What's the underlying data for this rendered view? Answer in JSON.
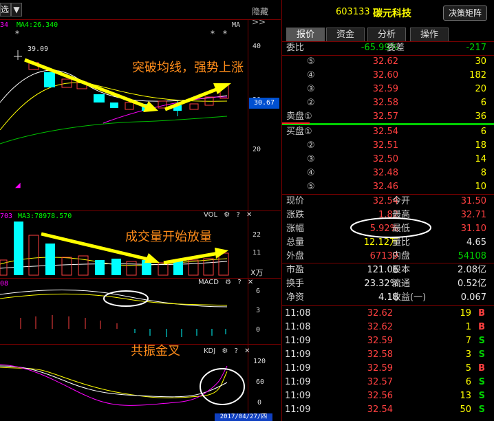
{
  "topbar": {
    "select_label": "选",
    "hide_label": "隐藏>>"
  },
  "kline": {
    "ma_label": "MA4:26.340",
    "ma_label_right": "MA",
    "left_stub": "34",
    "peak_label": "39.09",
    "price_axis": [
      "40",
      "30",
      "20"
    ],
    "current_price_tag": "30.67",
    "annotation": "突破均线，强势上涨"
  },
  "volume": {
    "left_stub": "703",
    "ma_label": "MA3:78978.570",
    "panel_name": "VOL",
    "axis": [
      "22",
      "11"
    ],
    "unit": "X万",
    "annotation": "成交量开始放量"
  },
  "macd": {
    "left_stub": "08",
    "panel_name": "MACD",
    "axis": [
      "6",
      "3",
      "0"
    ]
  },
  "kdj": {
    "panel_name": "KDJ",
    "axis": [
      "120",
      "60",
      "0"
    ],
    "annotation": "共振金叉",
    "date_label": "2017/04/27/四"
  },
  "quote": {
    "code": "603133",
    "name": "碳元科技",
    "matrix_button": "决策矩阵",
    "tabs": [
      "报价",
      "资金",
      "分析",
      "操作"
    ],
    "webi": {
      "label": "委比",
      "value": "-65.99%",
      "label2": "委差",
      "value2": "-217"
    },
    "asks": [
      {
        "level": "⑤",
        "price": "32.62",
        "vol": "30"
      },
      {
        "level": "④",
        "price": "32.60",
        "vol": "182"
      },
      {
        "level": "③",
        "price": "32.59",
        "vol": "20"
      },
      {
        "level": "②",
        "price": "32.58",
        "vol": "6"
      },
      {
        "level": "卖盘①",
        "price": "32.57",
        "vol": "36"
      }
    ],
    "bids": [
      {
        "level": "买盘①",
        "price": "32.54",
        "vol": "6"
      },
      {
        "level": "②",
        "price": "32.51",
        "vol": "18"
      },
      {
        "level": "③",
        "price": "32.50",
        "vol": "14"
      },
      {
        "level": "④",
        "price": "32.48",
        "vol": "8"
      },
      {
        "level": "⑤",
        "price": "32.46",
        "vol": "10"
      }
    ],
    "stats": [
      {
        "l": "现价",
        "v": "32.54",
        "m": "今开",
        "r": "31.50",
        "vc": "red",
        "rc": "red"
      },
      {
        "l": "涨跌",
        "v": "1.82",
        "m": "最高",
        "r": "32.71",
        "vc": "red",
        "rc": "red"
      },
      {
        "l": "涨幅",
        "v": "5.92%",
        "m": "最低",
        "r": "31.10",
        "vc": "red",
        "rc": "red"
      },
      {
        "l": "总量",
        "v": "12.12万",
        "m": "量比",
        "r": "4.65",
        "vc": "yellow",
        "rc": "white"
      },
      {
        "l": "外盘",
        "v": "67139",
        "m": "内盘",
        "r": "54108",
        "vc": "red",
        "rc": "green"
      }
    ],
    "fund": [
      {
        "l": "市盈",
        "v": "121.06",
        "m": "股本",
        "r": "2.08亿"
      },
      {
        "l": "换手",
        "v": "23.32%",
        "m": "流通",
        "r": "0.52亿"
      },
      {
        "l": "净资",
        "v": "4.18",
        "m": "收益(一)",
        "r": "0.067"
      }
    ],
    "trades": [
      {
        "t": "11:08",
        "p": "32.62",
        "v": "19",
        "s": "B"
      },
      {
        "t": "11:08",
        "p": "32.62",
        "v": "1",
        "s": "B"
      },
      {
        "t": "11:09",
        "p": "32.59",
        "v": "7",
        "s": "S"
      },
      {
        "t": "11:09",
        "p": "32.58",
        "v": "3",
        "s": "S"
      },
      {
        "t": "11:09",
        "p": "32.59",
        "v": "5",
        "s": "B"
      },
      {
        "t": "11:09",
        "p": "32.57",
        "v": "6",
        "s": "S"
      },
      {
        "t": "11:09",
        "p": "32.56",
        "v": "13",
        "s": "S"
      },
      {
        "t": "11:09",
        "p": "32.54",
        "v": "50",
        "s": "S"
      }
    ]
  }
}
